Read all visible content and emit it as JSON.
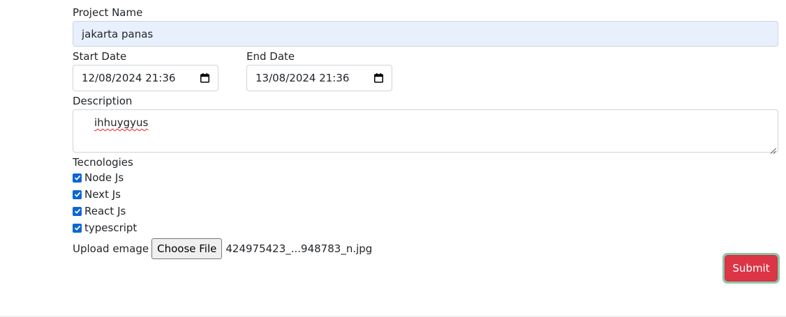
{
  "form": {
    "project_name_label": "Project Name",
    "project_name_value": "jakarta panas",
    "start_date_label": "Start Date",
    "start_date_value": "12/08/2024 21:36",
    "end_date_label": "End Date",
    "end_date_value": "13/08/2024 21:36",
    "description_label": "Description",
    "description_value": "ihhuygyus",
    "technologies_label": "Tecnologies",
    "technologies": [
      {
        "label": "Node Js",
        "checked": true
      },
      {
        "label": "Next Js",
        "checked": true
      },
      {
        "label": "React Js",
        "checked": true
      },
      {
        "label": "typescript",
        "checked": true
      }
    ],
    "upload_label": "Upload emage",
    "choose_file_label": "Choose File",
    "file_name": "424975423_...948783_n.jpg",
    "submit_label": "Submit"
  },
  "icons": {
    "calendar": "calendar-icon",
    "check": "check-icon",
    "resize": "resize-handle-icon"
  },
  "colors": {
    "autofill_bg": "#e8f0fe",
    "checkbox": "#0b66d6",
    "submit": "#dc3545",
    "focus_ring": "#8fc4a7"
  }
}
